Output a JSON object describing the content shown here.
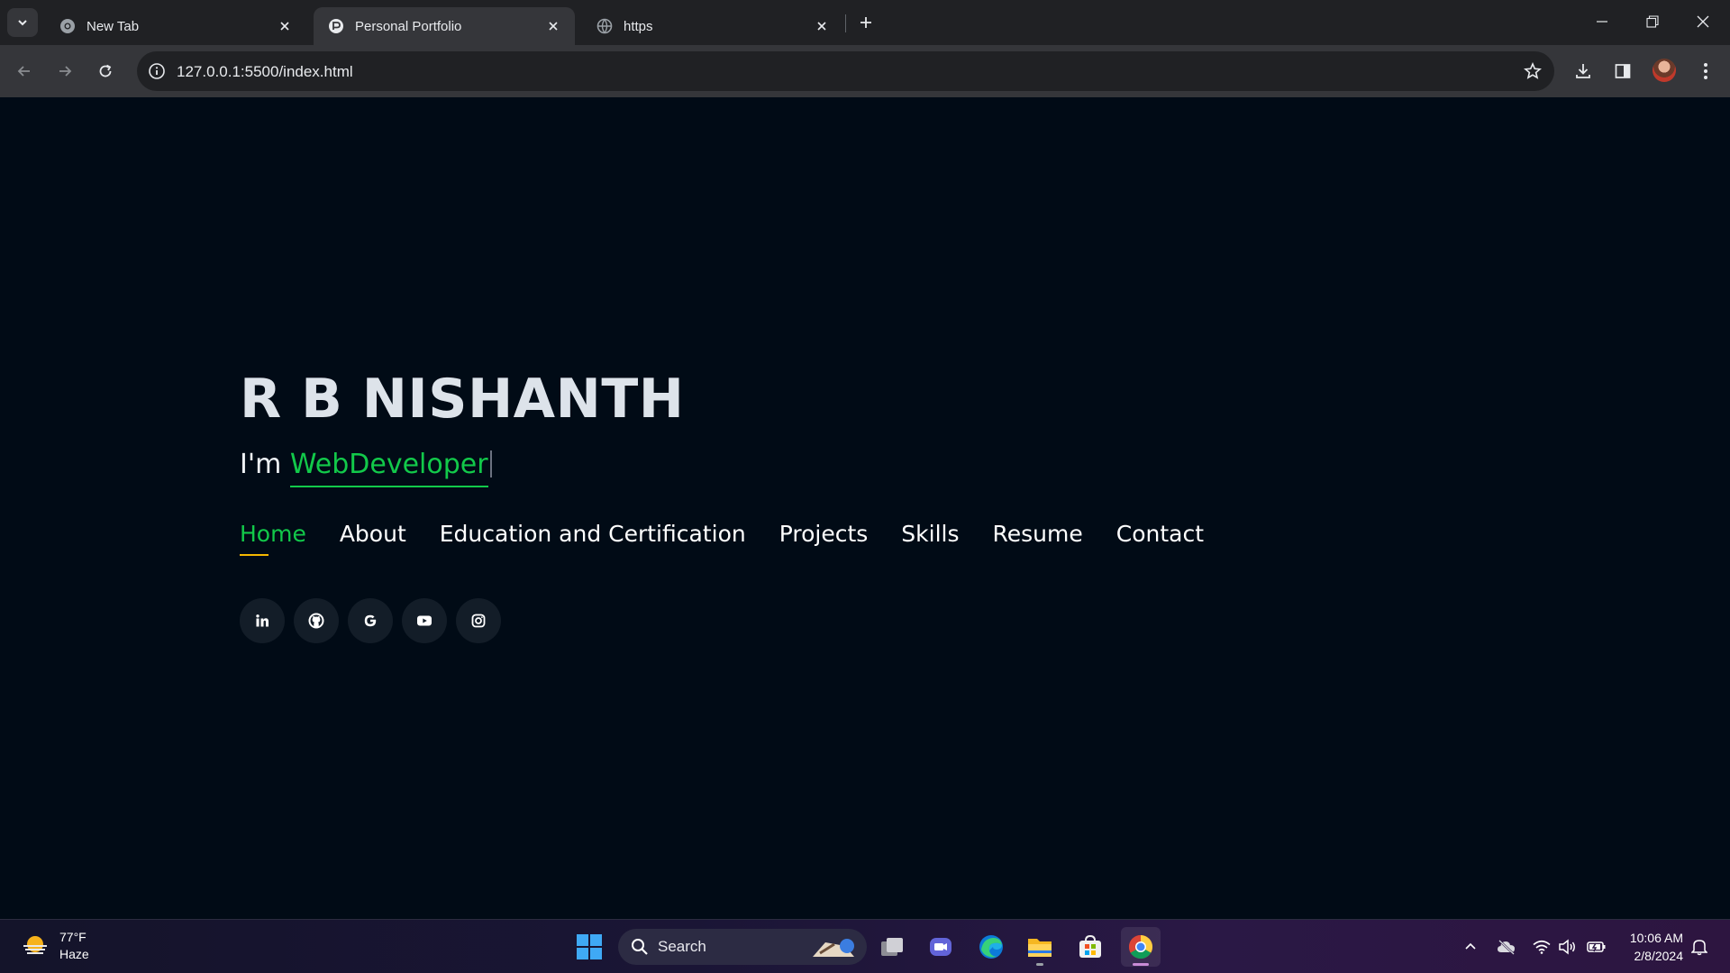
{
  "browser": {
    "tabs": [
      {
        "title": "New Tab",
        "icon": "chrome-icon"
      },
      {
        "title": "Personal Portfolio",
        "icon": "portfolio-favicon",
        "active": true
      },
      {
        "title": "https",
        "icon": "globe-icon"
      }
    ],
    "url": "127.0.0.1:5500/index.html"
  },
  "hero": {
    "name": "R B NISHANTH",
    "role_prefix": "I'm ",
    "role_typed": "WebDeveloper",
    "accent_color": "#12c94a",
    "underline_color": "#f5b800"
  },
  "nav": {
    "items": [
      {
        "label": "Home",
        "active": true
      },
      {
        "label": "About"
      },
      {
        "label": "Education and Certification"
      },
      {
        "label": "Projects"
      },
      {
        "label": "Skills"
      },
      {
        "label": "Resume"
      },
      {
        "label": "Contact"
      }
    ]
  },
  "social": [
    "linkedin-icon",
    "github-icon",
    "google-icon",
    "youtube-icon",
    "instagram-icon"
  ],
  "taskbar": {
    "weather_temp": "77°F",
    "weather_desc": "Haze",
    "search_label": "Search",
    "time": "10:06 AM",
    "date": "2/8/2024"
  }
}
